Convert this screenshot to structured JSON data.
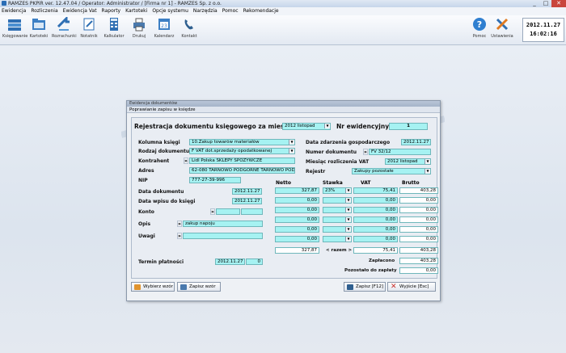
{
  "window": {
    "title": "RAMZES PKPiR ver. 12.47.04 /  Operator: Administrator /  [Firma nr 1] - RAMZES Sp. z o.o.",
    "min": "_",
    "max": "□",
    "close": "✕"
  },
  "menu": [
    "Ewidencja",
    "Rozliczenia",
    "Ewidencja Vat",
    "Raporty",
    "Kartoteki",
    "Opcje systemu",
    "Narzędzia",
    "Pomoc",
    "Rekomendacje"
  ],
  "toolbar": {
    "items": [
      {
        "label": "Księgowanie",
        "icon": "books-icon"
      },
      {
        "label": "Kartoteki",
        "icon": "folders-icon"
      },
      {
        "label": "Rozrachunki",
        "icon": "arrows-icon"
      },
      {
        "label": "Notatnik",
        "icon": "notepad-icon"
      },
      {
        "label": "Kalkulator",
        "icon": "calculator-icon"
      },
      {
        "label": "Drukuj",
        "icon": "printer-icon"
      },
      {
        "label": "Kalendarz",
        "icon": "calendar-icon"
      },
      {
        "label": "Kontakt",
        "icon": "phone-icon"
      }
    ],
    "help": "Pomoc",
    "settings": "Ustawienia",
    "date": "2012.11.27",
    "time": "16:02:16"
  },
  "dialog": {
    "title": "Ewidencja dokumentów",
    "subtitle": "Poprawianie zapisu w księdze",
    "heading": "Rejestracja dokumentu księgowego za miesiąc",
    "month": "2012 listopad",
    "nr_label": "Nr ewidencyjny",
    "nr_value": "1",
    "labels": {
      "kolumna": "Kolumna księgi",
      "rodzaj": "Rodzaj dokumentu",
      "kontrahent": "Kontrahent",
      "adres": "Adres",
      "nip": "NIP",
      "data_zdarzenia": "Data zdarzenia gospodarczego",
      "numer_dok": "Numer dokumentu",
      "miesiac_vat": "Miesiąc rozliczenia VAT",
      "rejestr": "Rejestr",
      "data_dok": "Data dokumentu",
      "data_wpisu": "Data wpisu do księgi",
      "konto": "Konto",
      "opis": "Opis",
      "uwagi": "Uwagi",
      "termin": "Termin płatności",
      "netto": "Netto",
      "stawka": "Stawka",
      "vat": "VAT",
      "brutto": "Brutto",
      "razem": "< razem >",
      "zaplacono": "Zapłacono",
      "pozostalo": "Pozostało do zapłaty"
    },
    "values": {
      "kolumna": "10.Zakup towarów materiałów",
      "rodzaj": "F VAT dot.sprzedaży opodatkowanej",
      "kontrahent": "Lidl Polska SKLEPY SPOŻYWCZE",
      "adres": "62-080 TARNOWO PODGÓRNE TARNOWO POD",
      "nip": "777-27-39-996",
      "data_zdarzenia": "2012.11.27",
      "numer_dok": "FV 32/12",
      "miesiac_vat": "2012 listopad",
      "rejestr": "Zakupy pozostałe",
      "data_dok": "2012.11.27",
      "data_wpisu": "2012.11.27",
      "opis": "zakup napoju",
      "termin_date": "2012.11.27",
      "termin_days": "0",
      "zaplacono": "403,28",
      "pozostalo": "0,00"
    },
    "rows": [
      {
        "netto": "327,87",
        "stawka": "23%",
        "vat": "75,41",
        "brutto": "403,28"
      },
      {
        "netto": "0,00",
        "stawka": "",
        "vat": "0,00",
        "brutto": "0,00"
      },
      {
        "netto": "0,00",
        "stawka": "",
        "vat": "0,00",
        "brutto": "0,00"
      },
      {
        "netto": "0,00",
        "stawka": "",
        "vat": "0,00",
        "brutto": "0,00"
      },
      {
        "netto": "0,00",
        "stawka": "",
        "vat": "0,00",
        "brutto": "0,00"
      },
      {
        "netto": "0,00",
        "stawka": "",
        "vat": "0,00",
        "brutto": "0,00"
      }
    ],
    "totals": {
      "netto": "327,87",
      "vat": "75,41",
      "brutto": "403,28"
    },
    "buttons": {
      "wybierz": "Wybierz wzór",
      "zapisz_wzor": "Zapisz wzór",
      "zapisz": "Zapisz  [F12]",
      "wyjscie": "Wyjście  [Esc]"
    }
  }
}
